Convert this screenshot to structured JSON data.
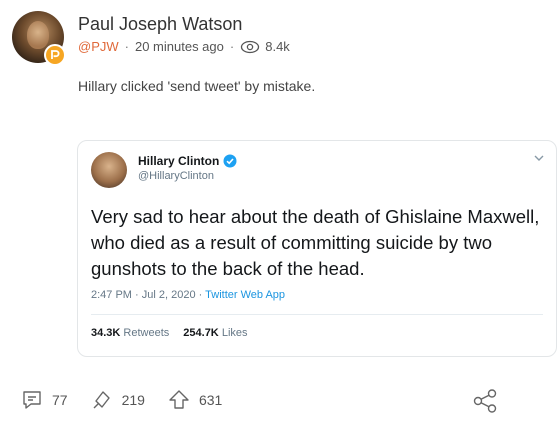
{
  "post": {
    "author_name": "Paul Joseph Watson",
    "handle": "@PJW",
    "time_ago": "20 minutes ago",
    "views": "8.4k",
    "text": "Hillary clicked 'send tweet' by mistake.",
    "badge_color": "#f6a623"
  },
  "embedded_tweet": {
    "name": "Hillary Clinton",
    "handle": "@HillaryClinton",
    "text": "Very sad to hear about the death of Ghislaine Maxwell, who died as a result of committing suicide by two gunshots to the back of the head.",
    "timestamp": "2:47 PM · Jul 2, 2020 · ",
    "source": "Twitter Web App",
    "retweets_count": "34.3K",
    "retweets_label": "Retweets",
    "likes_count": "254.7K",
    "likes_label": "Likes",
    "verified_color": "#1da1f2"
  },
  "actions": {
    "comments": "77",
    "reposts": "219",
    "upvotes": "631"
  },
  "icons": [
    "eye-icon",
    "verified-icon",
    "chevron-down-icon",
    "comment-icon",
    "repost-icon",
    "upvote-icon",
    "share-icon",
    "parler-badge-icon"
  ]
}
